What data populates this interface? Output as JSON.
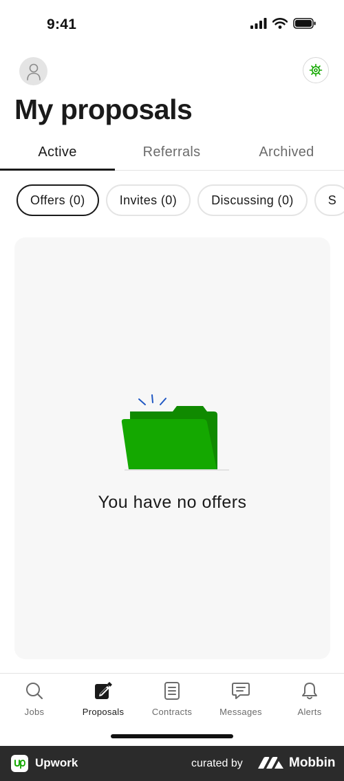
{
  "status_bar": {
    "time": "9:41"
  },
  "header": {
    "title": "My proposals"
  },
  "tabs": [
    {
      "label": "Active",
      "active": true
    },
    {
      "label": "Referrals",
      "active": false
    },
    {
      "label": "Archived",
      "active": false
    }
  ],
  "filters": [
    {
      "label": "Offers (0)",
      "active": true
    },
    {
      "label": "Invites (0)",
      "active": false
    },
    {
      "label": "Discussing (0)",
      "active": false
    },
    {
      "label": "S",
      "active": false
    }
  ],
  "empty_state": {
    "message": "You have no offers",
    "icon": "open-folder-illustration"
  },
  "bottom_nav": [
    {
      "label": "Jobs",
      "icon": "search-icon",
      "active": false
    },
    {
      "label": "Proposals",
      "icon": "proposals-icon",
      "active": true
    },
    {
      "label": "Contracts",
      "icon": "document-icon",
      "active": false
    },
    {
      "label": "Messages",
      "icon": "chat-icon",
      "active": false
    },
    {
      "label": "Alerts",
      "icon": "bell-icon",
      "active": false
    }
  ],
  "branding": {
    "app_name": "Upwork",
    "curated_by": "curated by",
    "curator": "Mobbin"
  },
  "colors": {
    "accent_green": "#14a800",
    "text_primary": "#1a1a1a",
    "text_secondary": "#6b6b6b",
    "card_bg": "#f7f7f7"
  }
}
